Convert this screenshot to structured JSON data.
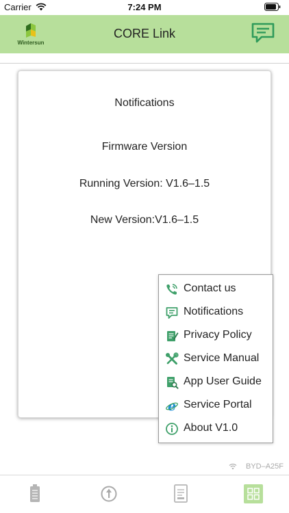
{
  "status_bar": {
    "carrier": "Carrier",
    "time": "7:24 PM",
    "icons": [
      "wifi-icon",
      "battery-icon"
    ]
  },
  "header": {
    "logo_text": "Wintersun",
    "title": "CORE Link",
    "right_icon": "message-icon"
  },
  "card": {
    "title": "Notifications",
    "firmware_heading": "Firmware Version",
    "running_version": "Running Version: V1.6–1.5",
    "new_version": "New Version:V1.6–1.5"
  },
  "menu": {
    "items": [
      {
        "label": "Contact us",
        "icon": "phone-icon"
      },
      {
        "label": "Notifications",
        "icon": "notification-icon"
      },
      {
        "label": "Privacy Policy",
        "icon": "privacy-policy-icon"
      },
      {
        "label": "Service Manual",
        "icon": "tools-icon"
      },
      {
        "label": "App User Guide",
        "icon": "user-guide-icon"
      },
      {
        "label": "Service Portal",
        "icon": "browser-icon"
      },
      {
        "label": "About V1.0",
        "icon": "info-icon"
      }
    ]
  },
  "device": {
    "name": "BYD–A25F"
  },
  "tabbar": {
    "tabs": [
      "battery-tab-icon",
      "arrow-up-tab-icon",
      "document-tab-icon",
      "grid-tab-icon"
    ],
    "active_index": 3
  },
  "colors": {
    "header_bg": "#b7df9b",
    "accent_green": "#2e9a5a",
    "inactive_tab": "#b5b5b5"
  }
}
